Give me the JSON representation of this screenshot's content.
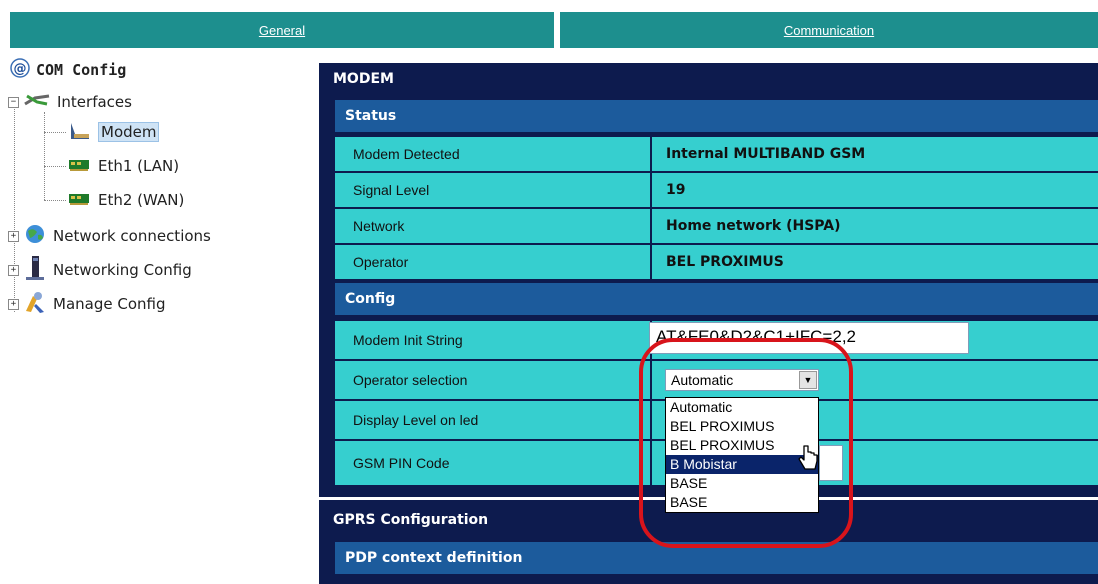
{
  "tabs": {
    "general": "General",
    "communication": "Communication"
  },
  "tree": {
    "root": "COM Config",
    "interfaces": "Interfaces",
    "modem": "Modem",
    "eth1": "Eth1 (LAN)",
    "eth2": "Eth2 (WAN)",
    "network_connections": "Network connections",
    "networking_config": "Networking Config",
    "manage_config": "Manage Config"
  },
  "panel": {
    "title": "MODEM",
    "status_header": "Status",
    "status_rows": [
      {
        "label": "Modem Detected",
        "value": "Internal MULTIBAND GSM"
      },
      {
        "label": "Signal Level",
        "value": "19"
      },
      {
        "label": "Network",
        "value": "Home network (HSPA)"
      },
      {
        "label": "Operator",
        "value": "BEL PROXIMUS"
      }
    ],
    "config_header": "Config",
    "config_rows": {
      "init_label": "Modem Init String",
      "init_value": "AT&FE0&D2&C1+IFC=2,2",
      "operator_label": "Operator selection",
      "operator_selected": "Automatic",
      "display_label": "Display Level on led",
      "pin_label": "GSM PIN Code"
    },
    "operator_options": [
      "Automatic",
      "BEL PROXIMUS",
      "BEL PROXIMUS",
      "B Mobistar",
      "BASE",
      "BASE"
    ],
    "highlighted_option": "B Mobistar"
  },
  "gprs": {
    "title": "GPRS Configuration",
    "pdp_header": "PDP context definition"
  },
  "colors": {
    "tab": "#1d8f8e",
    "panel": "#0d1b4e",
    "section": "#1c5b9c",
    "cell": "#36cfcf",
    "ring": "#d8141b"
  }
}
